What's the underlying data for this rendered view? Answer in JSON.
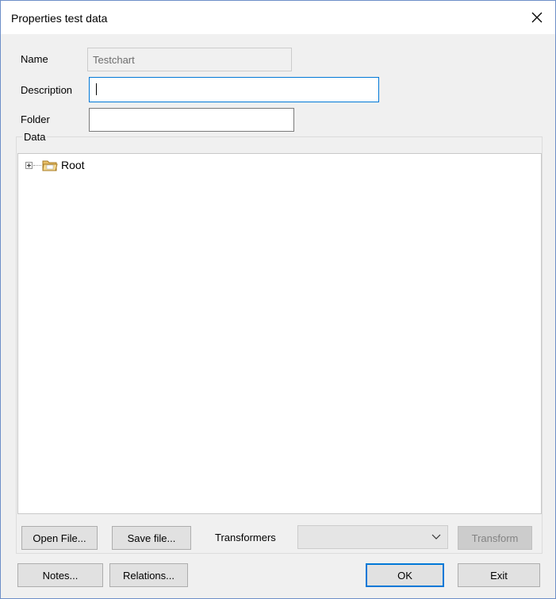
{
  "dialog": {
    "title": "Properties test data",
    "close_symbol": "✕"
  },
  "form": {
    "name_label": "Name",
    "name_value": "Testchart",
    "description_label": "Description",
    "description_value": "",
    "folder_label": "Folder",
    "folder_value": ""
  },
  "data_group": {
    "label": "Data",
    "tree": {
      "root_label": "Root",
      "root_icon": "folder-icon",
      "expander_icon": "expand-plus-icon"
    }
  },
  "toolbar": {
    "open_file_label": "Open File...",
    "save_file_label": "Save file...",
    "transformers_label": "Transformers",
    "transformers_selected": "",
    "transform_label": "Transform"
  },
  "footer": {
    "notes_label": "Notes...",
    "relations_label": "Relations...",
    "ok_label": "OK",
    "exit_label": "Exit"
  },
  "colors": {
    "focus_border": "#0078d7",
    "window_border": "#6d8fc8",
    "folder_fill": "#e8c06a"
  }
}
